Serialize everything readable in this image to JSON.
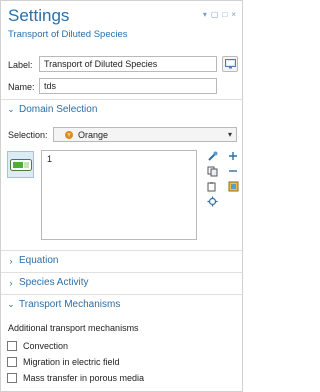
{
  "header": {
    "title": "Settings",
    "subtitle": "Transport of Diluted Species",
    "controls": [
      "▾",
      "▢",
      "□",
      "×"
    ]
  },
  "label_field": {
    "label": "Label:",
    "value": "Transport of Diluted Species"
  },
  "name_field": {
    "label": "Name:",
    "value": "tds"
  },
  "sections": {
    "domain_selection": "Domain Selection",
    "equation": "Equation",
    "species_activity": "Species Activity",
    "transport_mechanisms": "Transport Mechanisms"
  },
  "selection": {
    "label": "Selection:",
    "value": "Orange"
  },
  "selection_list": [
    "1"
  ],
  "transport": {
    "heading": "Additional transport mechanisms",
    "options": [
      {
        "label": "Convection",
        "checked": false
      },
      {
        "label": "Migration in electric field",
        "checked": false
      },
      {
        "label": "Mass transfer in porous media",
        "checked": false
      }
    ]
  },
  "colors": {
    "accent": "#2a6fa8",
    "selection_icon": "#e08a1e"
  },
  "icons": {
    "label_action": "screen-edit-icon",
    "domain_toggle": "active-toggle-icon",
    "tools": [
      "paste-selection-icon",
      "add-icon",
      "copy-icon",
      "remove-icon",
      "clear-selection-icon",
      "color-icon",
      "zoom-to-selection-icon"
    ]
  }
}
